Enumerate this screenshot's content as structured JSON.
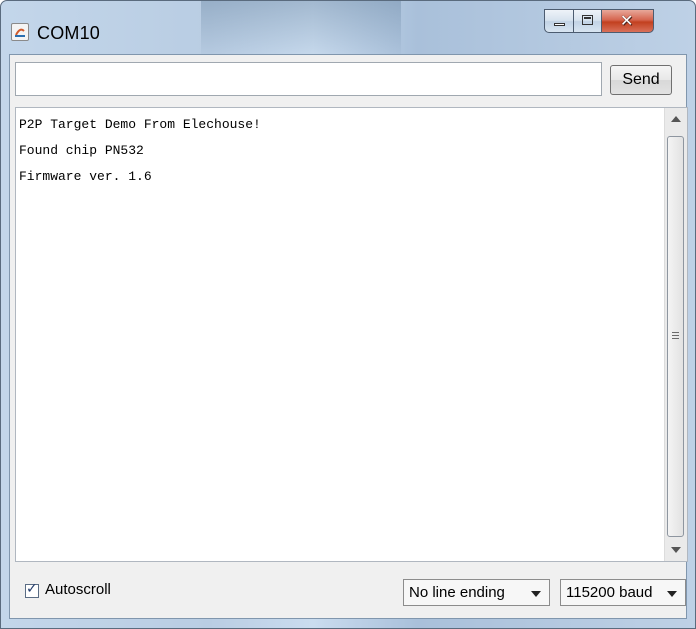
{
  "window": {
    "title": "COM10"
  },
  "send_bar": {
    "input_value": "",
    "send_label": "Send"
  },
  "output": {
    "lines": [
      "P2P Target Demo From Elechouse!",
      "Found chip PN532",
      "Firmware ver. 1.6"
    ]
  },
  "bottom": {
    "autoscroll_label": "Autoscroll",
    "autoscroll_checked": true,
    "line_ending": "No line ending",
    "baud_rate": "115200 baud"
  },
  "icons": [
    "arduino-app-icon",
    "minimize-icon",
    "maximize-icon",
    "close-icon",
    "scroll-up-icon",
    "scroll-down-icon",
    "checkmark-icon",
    "dropdown-caret-icon"
  ]
}
